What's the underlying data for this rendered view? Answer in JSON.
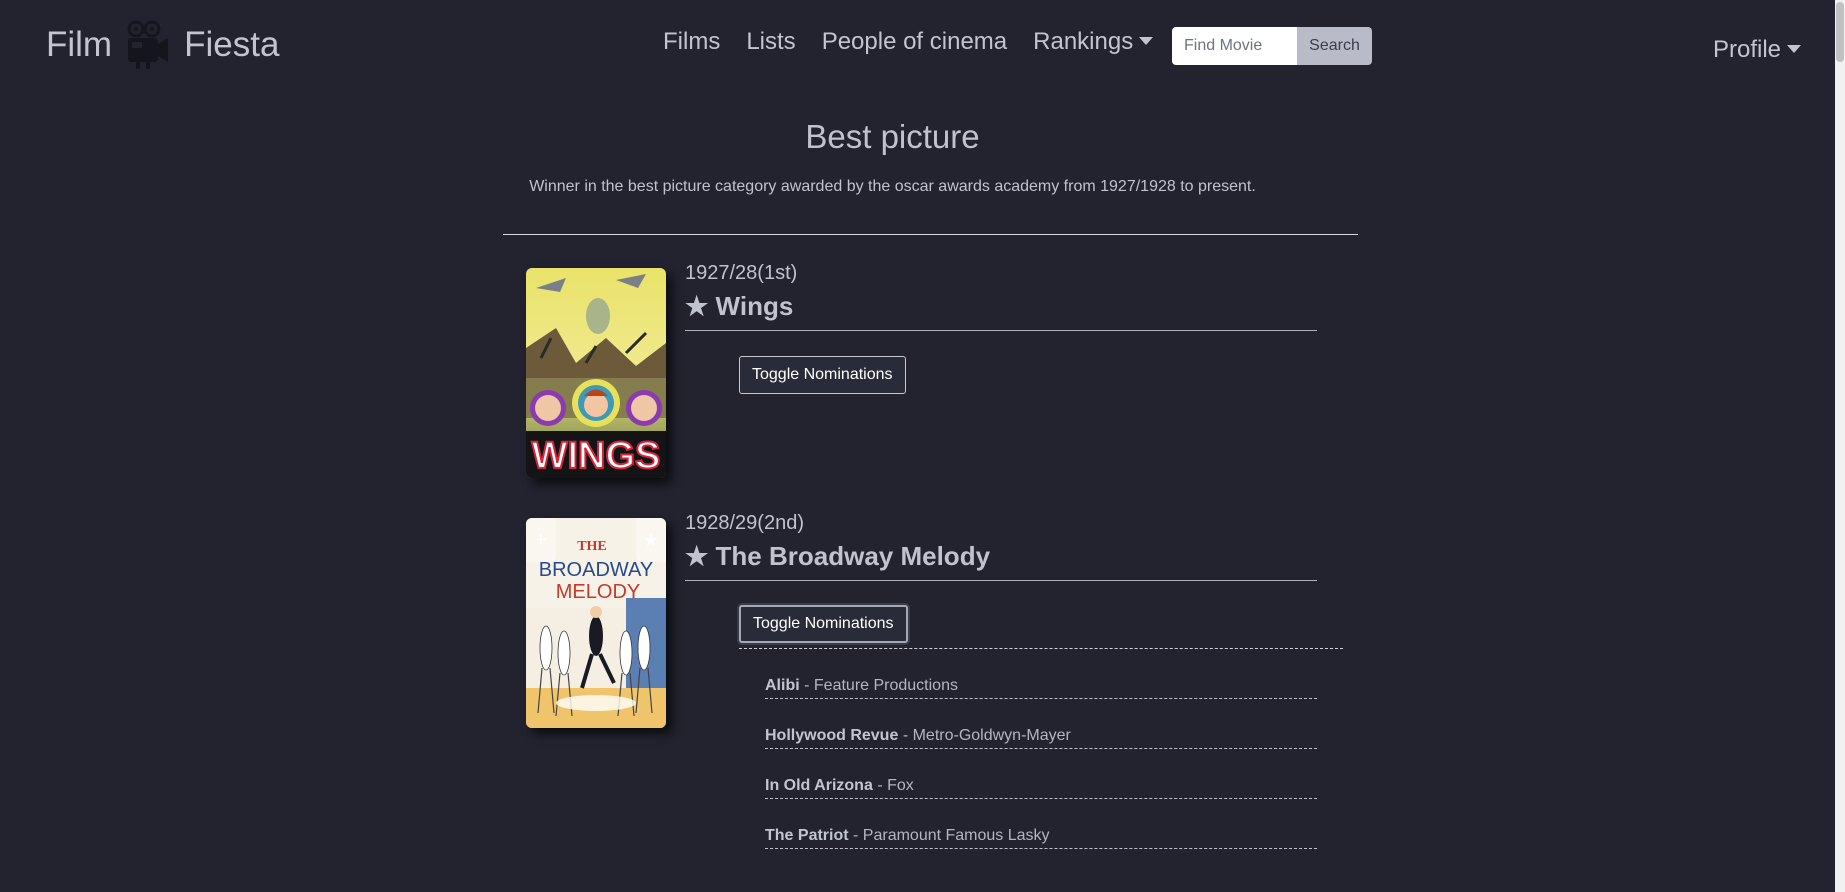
{
  "nav": {
    "brand_left": "Film",
    "brand_right": "Fiesta",
    "links": [
      "Films",
      "Lists",
      "People of cinema"
    ],
    "rankings_label": "Rankings",
    "search_placeholder": "Find Movie",
    "search_button": "Search",
    "profile_label": "Profile"
  },
  "header": {
    "title": "Best picture",
    "description": "Winner in the best picture category awarded by the oscar awards academy from 1927/1928 to present."
  },
  "entries": [
    {
      "year": "1927/28(1st)",
      "winner": "★ Wings",
      "toggle_label": "Toggle Nominations",
      "poster_text": "WINGS",
      "nominations": []
    },
    {
      "year": "1928/29(2nd)",
      "winner": "★ The Broadway Melody",
      "toggle_label": "Toggle Nominations",
      "poster_text_top": "THE",
      "poster_text_mid": "BROADWAY",
      "poster_text_bot": "MELODY",
      "poster_plus": "+",
      "poster_star": "★",
      "nominations": [
        {
          "title": "Alibi",
          "studio": "- Feature Productions"
        },
        {
          "title": "Hollywood Revue",
          "studio": "- Metro-Goldwyn-Mayer"
        },
        {
          "title": "In Old Arizona",
          "studio": "- Fox"
        },
        {
          "title": "The Patriot",
          "studio": "- Paramount Famous Lasky"
        }
      ]
    }
  ],
  "colors": {
    "background": "#22232f",
    "text": "#c0c2ce",
    "search_button": "#b9bbc8"
  },
  "icons": {
    "brand": "film-camera-icon",
    "dropdown": "caret-down-icon"
  }
}
